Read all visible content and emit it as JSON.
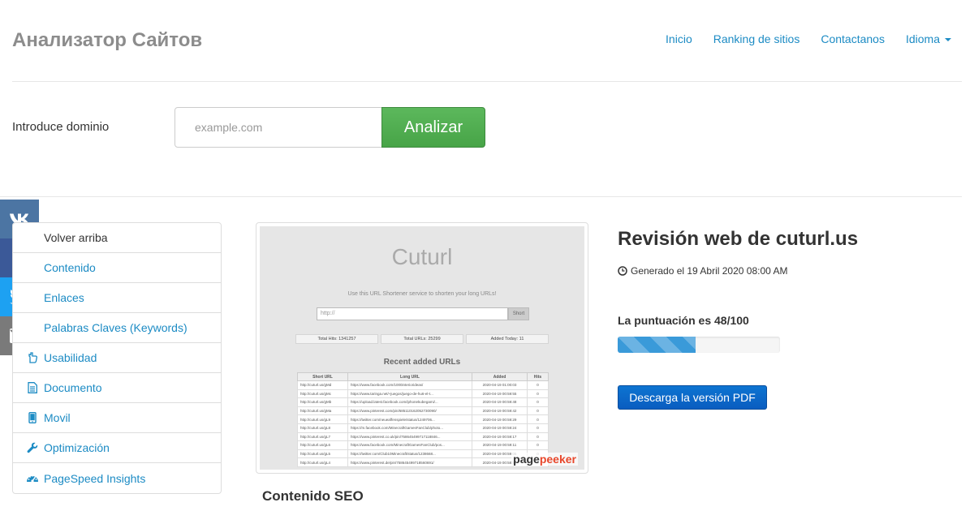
{
  "header": {
    "brand": "Анализатор Сайтов",
    "nav": [
      "Inicio",
      "Ranking de sitios",
      "Contactanos",
      "Idioma"
    ]
  },
  "search": {
    "label": "Introduce dominio",
    "placeholder": "example.com",
    "button": "Analizar"
  },
  "social": [
    "vk-icon",
    "facebook-icon",
    "twitter-icon",
    "email-icon"
  ],
  "toc": {
    "items": [
      {
        "label": "Volver arriba",
        "icon": "arrow-up-icon"
      },
      {
        "label": "Contenido",
        "icon": "file-icon"
      },
      {
        "label": "Enlaces",
        "icon": "link-icon"
      },
      {
        "label": "Palabras Claves (Keywords)",
        "icon": "key-icon"
      },
      {
        "label": "Usabilidad",
        "icon": "hand-icon"
      },
      {
        "label": "Documento",
        "icon": "document-icon"
      },
      {
        "label": "Movil",
        "icon": "mobile-icon"
      },
      {
        "label": "Optimización",
        "icon": "wrench-icon"
      },
      {
        "label": "PageSpeed Insights",
        "icon": "dashboard-icon"
      }
    ]
  },
  "thumbnail": {
    "title": "Cuturl",
    "subtitle": "Use this URL Shortener service to shorten your long URLs!",
    "input_placeholder": "http://",
    "short_button": "Short",
    "stats": [
      "Total Hits: 1341257",
      "Total URLs: 25299",
      "Added Today: 11"
    ],
    "recent_title": "Recent added URLs",
    "table_headers": [
      "Short URL",
      "Long URL",
      "Added",
      "Hits"
    ],
    "rows": [
      [
        "http://cuturl.us/gMd",
        "https://www.facebook.com/1000interiorideas/",
        "2020-04-19 01:00:03",
        "0"
      ],
      [
        "http://cuturl.us/gMc",
        "https://www.taringa.net/+juegos/juego-de-hu6-el-t...",
        "2020-04-19 00:59:55",
        "0"
      ],
      [
        "http://cuturl.us/gMb",
        "https://upload.latest.facebook.com/iphonekubegami/...",
        "2020-04-19 00:59:48",
        "0"
      ],
      [
        "http://cuturl.us/gMa",
        "https://www.pinterest.com/pin/685110162052730090/",
        "2020-04-19 00:59:42",
        "0"
      ],
      [
        "http://cuturl.us/gL9",
        "https://twitter.com/neueaffenspiele/status/1249706...",
        "2020-04-19 00:59:29",
        "0"
      ],
      [
        "http://cuturl.us/gL8",
        "https://m.facebook.com/MinecraftGamesFanClub/photo...",
        "2020-04-19 00:59:24",
        "0"
      ],
      [
        "http://cuturl.us/gL7",
        "https://www.pinterest.co.uk/pin/758645499717118846...",
        "2020-04-19 00:59:17",
        "0"
      ],
      [
        "http://cuturl.us/gL6",
        "https://www.facebook.com/MinecraftGamesFanClub/pos...",
        "2020-04-19 00:59:11",
        "0"
      ],
      [
        "http://cuturl.us/gL5",
        "https://twitter.com/Club10Minecraft/status/1238668...",
        "2020-04-19 00:59:05",
        "0"
      ],
      [
        "http://cuturl.us/gL4",
        "https://www.pinterest.de/pin/758645499718560691/",
        "2020-04-19 00:58:59",
        "0"
      ]
    ],
    "watermark_a": "page",
    "watermark_b": "peeker"
  },
  "seo_title": "Contenido SEO",
  "review": {
    "title": "Revisión web de cuturl.us",
    "generated": "Generado el 19 Abril 2020 08:00 AM",
    "score_label": "La puntuación es 48/100",
    "score": 48,
    "pdf_button": "Descarga la versión PDF"
  },
  "colors": {
    "link": "#1c8bc4",
    "brand": "#8c8c8c",
    "analyze_green": "#5cb85c",
    "pdf_blue": "#0a5dc0",
    "vk": "#4c75a3",
    "facebook": "#3b5998",
    "twitter": "#1da1f2",
    "email": "#7a7a7a"
  }
}
